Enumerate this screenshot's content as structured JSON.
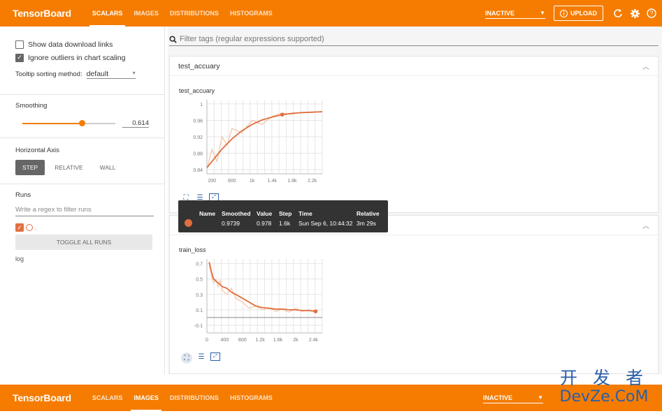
{
  "topbar": {
    "brand": "TensorBoard",
    "tabs": [
      {
        "label": "SCALARS",
        "active": true
      },
      {
        "label": "IMAGES",
        "active": false
      },
      {
        "label": "DISTRIBUTIONS",
        "active": false
      },
      {
        "label": "HISTOGRAMS",
        "active": false
      }
    ],
    "status": "INACTIVE",
    "upload": "UPLOAD",
    "icons": [
      "refresh-icon",
      "settings-icon",
      "help-icon"
    ]
  },
  "sidebar": {
    "show_download": "Show data download links",
    "ignore_outliers": "Ignore outliers in chart scaling",
    "tooltip_sort_label": "Tooltip sorting method:",
    "tooltip_sort_value": "default",
    "smoothing_label": "Smoothing",
    "smoothing_value": "0.614",
    "smoothing_fraction": 0.614,
    "horizontal_axis_label": "Horizontal Axis",
    "axis_options": [
      "STEP",
      "RELATIVE",
      "WALL"
    ],
    "runs_label": "Runs",
    "runs_filter_placeholder": "Write a regex to filter runs",
    "run_dot": ".",
    "toggle_all": "TOGGLE ALL RUNS",
    "run_name": "log"
  },
  "main": {
    "filter_placeholder": "Filter tags (regular expressions supported)",
    "card1_title": "test_accuary",
    "card2_title": "train_loss"
  },
  "tooltip": {
    "headers": [
      "Name",
      "Smoothed",
      "Value",
      "Step",
      "Time",
      "Relative"
    ],
    "values": [
      "",
      "0.9739",
      "0.978",
      "1.6k",
      "Sun Sep 6, 10:44:32",
      "3m 29s"
    ]
  },
  "bottombar": {
    "brand": "TensorBoard",
    "tabs": [
      {
        "label": "SCALARS",
        "active": false
      },
      {
        "label": "IMAGES",
        "active": true
      },
      {
        "label": "DISTRIBUTIONS",
        "active": false
      },
      {
        "label": "HISTOGRAMS",
        "active": false
      }
    ],
    "status": "INACTIVE"
  },
  "watermark": {
    "cn": "开 发 者",
    "en": "DevZe.CoM"
  },
  "chart_data": [
    {
      "type": "line",
      "title": "test_accuary",
      "x_ticks": [
        "200",
        "600",
        "1k",
        "1.4k",
        "1.8k",
        "2.2k"
      ],
      "y_ticks": [
        "0.84",
        "0.88",
        "0.92",
        "0.96",
        "1"
      ],
      "xlim": [
        100,
        2400
      ],
      "ylim": [
        0.83,
        1.01
      ],
      "smoothed": {
        "x": [
          100,
          200,
          300,
          400,
          600,
          800,
          1000,
          1200,
          1400,
          1600,
          1800,
          2000,
          2200,
          2400
        ],
        "y": [
          0.845,
          0.86,
          0.875,
          0.89,
          0.915,
          0.935,
          0.95,
          0.961,
          0.968,
          0.9739,
          0.977,
          0.979,
          0.98,
          0.981
        ]
      },
      "raw": {
        "x": [
          100,
          200,
          300,
          400,
          500,
          600,
          800,
          1000,
          1200,
          1400,
          1600,
          1800,
          2000,
          2200,
          2400
        ],
        "y": [
          0.84,
          0.89,
          0.86,
          0.92,
          0.9,
          0.94,
          0.93,
          0.96,
          0.95,
          0.97,
          0.978,
          0.975,
          0.98,
          0.979,
          0.982
        ]
      },
      "highlight": {
        "x": 1600,
        "y": 0.9739
      }
    },
    {
      "type": "line",
      "title": "train_loss",
      "x_ticks": [
        "0",
        "400",
        "800",
        "1.2k",
        "1.6k",
        "2k",
        "2.4k"
      ],
      "y_ticks": [
        "0.7",
        "0.5",
        "0.3",
        "0.1",
        "-0.1"
      ],
      "xlim": [
        0,
        2600
      ],
      "ylim": [
        -0.2,
        0.76
      ],
      "smoothed": {
        "x": [
          50,
          100,
          150,
          250,
          350,
          450,
          550,
          650,
          800,
          950,
          1100,
          1250,
          1400,
          1550,
          1700,
          1850,
          2000,
          2150,
          2300,
          2450
        ],
        "y": [
          0.72,
          0.6,
          0.5,
          0.45,
          0.4,
          0.38,
          0.33,
          0.3,
          0.25,
          0.2,
          0.15,
          0.13,
          0.12,
          0.11,
          0.11,
          0.1,
          0.1,
          0.09,
          0.09,
          0.08
        ]
      },
      "raw": {
        "x": [
          50,
          100,
          150,
          200,
          250,
          300,
          350,
          450,
          550,
          650,
          800,
          950,
          1100,
          1250,
          1400,
          1550,
          1700,
          1850,
          2000,
          2150,
          2300,
          2450
        ],
        "y": [
          0.7,
          0.55,
          0.45,
          0.5,
          0.4,
          0.48,
          0.35,
          0.3,
          0.38,
          0.25,
          0.2,
          0.12,
          0.15,
          0.1,
          0.13,
          0.08,
          0.11,
          0.07,
          0.12,
          0.08,
          0.1,
          0.08
        ]
      },
      "highlight": {
        "x": 2450,
        "y": 0.08
      }
    }
  ]
}
